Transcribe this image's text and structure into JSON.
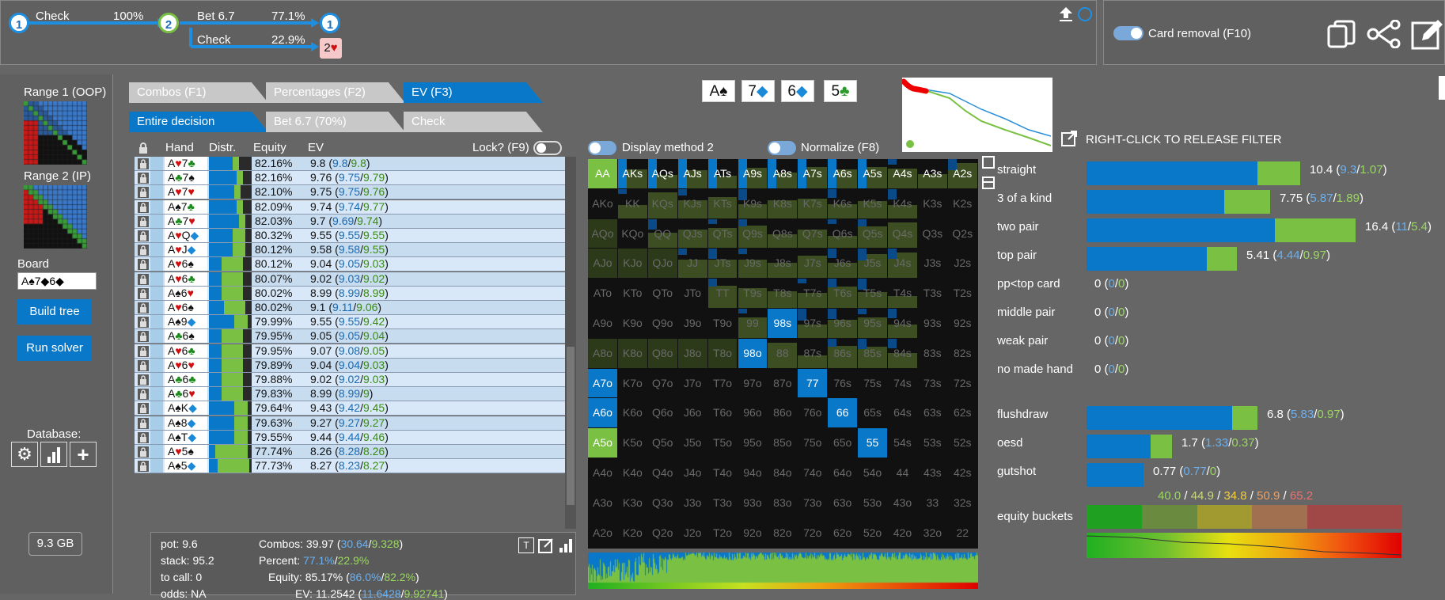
{
  "tree": {
    "n1": "1",
    "n2": "2",
    "n3": "1",
    "n4": "2",
    "check_label": "Check",
    "check_pct": "100%",
    "bet_label": "Bet 6.7",
    "bet_pct": "77.1%",
    "check2_label": "Check",
    "check2_pct": "22.9%",
    "heart": "♥"
  },
  "card_removal_label": "Card removal (F10)",
  "left": {
    "range1": "Range 1 (OOP)",
    "range2": "Range 2 (IP)",
    "board_label": "Board",
    "board_value": "A♠7◆6◆",
    "build_tree": "Build tree",
    "run_solver": "Run solver",
    "database": "Database:",
    "memory": "9.3 GB"
  },
  "tabs1": [
    "Combos (F1)",
    "Percentages (F2)",
    "EV (F3)"
  ],
  "tabs2": [
    "Entire decision",
    "Bet 6.7 (70%)",
    "Check"
  ],
  "board_cards": [
    {
      "rank": "A",
      "suit": "♠",
      "color": "#111"
    },
    {
      "rank": "7",
      "suit": "◆",
      "color": "#1a8ad8"
    },
    {
      "rank": "6",
      "suit": "◆",
      "color": "#1a8ad8"
    },
    {
      "rank": "5",
      "suit": "♣",
      "color": "#2a9a2a"
    }
  ],
  "table": {
    "headers": {
      "hand": "Hand",
      "distr": "Distr.",
      "equity": "Equity",
      "ev": "EV",
      "lock": "Lock? (F9)"
    },
    "rows": [
      {
        "r1": "A",
        "s1": "♥",
        "c1": "#d01010",
        "r2": "7",
        "s2": "♣",
        "c2": "#1a8a1a",
        "equity": "82.16%",
        "ev": "9.8",
        "a": "9.8",
        "b": "9.8",
        "blue": 0.55,
        "green": 0.15
      },
      {
        "r1": "A",
        "s1": "♣",
        "c1": "#1a8a1a",
        "r2": "7",
        "s2": "♠",
        "c2": "#111",
        "equity": "82.16%",
        "ev": "9.76",
        "a": "9.75",
        "b": "9.79",
        "blue": 0.65,
        "green": 0.15
      },
      {
        "r1": "A",
        "s1": "♥",
        "c1": "#d01010",
        "r2": "7",
        "s2": "♥",
        "c2": "#d01010",
        "equity": "82.10%",
        "ev": "9.75",
        "a": "9.75",
        "b": "9.76",
        "blue": 0.6,
        "green": 0.15
      },
      {
        "r1": "A",
        "s1": "♠",
        "c1": "#111",
        "r2": "7",
        "s2": "♣",
        "c2": "#1a8a1a",
        "equity": "82.09%",
        "ev": "9.74",
        "a": "9.74",
        "b": "9.77",
        "blue": 0.65,
        "green": 0.15
      },
      {
        "r1": "A",
        "s1": "♣",
        "c1": "#1a8a1a",
        "r2": "7",
        "s2": "♥",
        "c2": "#d01010",
        "equity": "82.03%",
        "ev": "9.7",
        "a": "9.69",
        "b": "9.74",
        "blue": 0.7,
        "green": 0.15
      },
      {
        "r1": "A",
        "s1": "♥",
        "c1": "#d01010",
        "r2": "Q",
        "s2": "◆",
        "c2": "#1a8ad8",
        "equity": "80.32%",
        "ev": "9.55",
        "a": "9.55",
        "b": "9.55",
        "blue": 0.55,
        "green": 0.3
      },
      {
        "r1": "A",
        "s1": "♥",
        "c1": "#d01010",
        "r2": "J",
        "s2": "◆",
        "c2": "#1a8ad8",
        "equity": "80.12%",
        "ev": "9.58",
        "a": "9.58",
        "b": "9.55",
        "blue": 0.55,
        "green": 0.3
      },
      {
        "r1": "A",
        "s1": "♥",
        "c1": "#d01010",
        "r2": "6",
        "s2": "♠",
        "c2": "#111",
        "equity": "80.12%",
        "ev": "9.04",
        "a": "9.05",
        "b": "9.03",
        "blue": 0.3,
        "green": 0.5
      },
      {
        "r1": "A",
        "s1": "♥",
        "c1": "#d01010",
        "r2": "6",
        "s2": "♣",
        "c2": "#1a8a1a",
        "equity": "80.07%",
        "ev": "9.02",
        "a": "9.03",
        "b": "9.02",
        "blue": 0.3,
        "green": 0.5
      },
      {
        "r1": "A",
        "s1": "♠",
        "c1": "#111",
        "r2": "6",
        "s2": "♥",
        "c2": "#d01010",
        "equity": "80.02%",
        "ev": "8.99",
        "a": "8.99",
        "b": "8.99",
        "blue": 0.3,
        "green": 0.5
      },
      {
        "r1": "A",
        "s1": "♥",
        "c1": "#d01010",
        "r2": "6",
        "s2": "♠",
        "c2": "#111",
        "equity": "80.02%",
        "ev": "9.1",
        "a": "9.11",
        "b": "9.06",
        "blue": 0.35,
        "green": 0.5
      },
      {
        "r1": "A",
        "s1": "♠",
        "c1": "#111",
        "r2": "9",
        "s2": "◆",
        "c2": "#1a8ad8",
        "equity": "79.99%",
        "ev": "9.55",
        "a": "9.55",
        "b": "9.42",
        "blue": 0.6,
        "green": 0.3
      },
      {
        "r1": "A",
        "s1": "♣",
        "c1": "#1a8a1a",
        "r2": "6",
        "s2": "♠",
        "c2": "#111",
        "equity": "79.95%",
        "ev": "9.05",
        "a": "9.05",
        "b": "9.04",
        "blue": 0.3,
        "green": 0.5
      },
      {
        "r1": "A",
        "s1": "♥",
        "c1": "#d01010",
        "r2": "6",
        "s2": "♣",
        "c2": "#1a8a1a",
        "equity": "79.95%",
        "ev": "9.07",
        "a": "9.08",
        "b": "9.05",
        "blue": 0.3,
        "green": 0.5
      },
      {
        "r1": "A",
        "s1": "♥",
        "c1": "#d01010",
        "r2": "6",
        "s2": "♥",
        "c2": "#d01010",
        "equity": "79.89%",
        "ev": "9.04",
        "a": "9.04",
        "b": "9.03",
        "blue": 0.3,
        "green": 0.5
      },
      {
        "r1": "A",
        "s1": "♣",
        "c1": "#1a8a1a",
        "r2": "6",
        "s2": "♣",
        "c2": "#1a8a1a",
        "equity": "79.88%",
        "ev": "9.02",
        "a": "9.02",
        "b": "9.03",
        "blue": 0.3,
        "green": 0.5
      },
      {
        "r1": "A",
        "s1": "♣",
        "c1": "#1a8a1a",
        "r2": "6",
        "s2": "♥",
        "c2": "#d01010",
        "equity": "79.83%",
        "ev": "8.99",
        "a": "8.99",
        "b": "9",
        "blue": 0.3,
        "green": 0.5
      },
      {
        "r1": "A",
        "s1": "♠",
        "c1": "#111",
        "r2": "K",
        "s2": "◆",
        "c2": "#1a8ad8",
        "equity": "79.64%",
        "ev": "9.43",
        "a": "9.42",
        "b": "9.45",
        "blue": 0.6,
        "green": 0.3
      },
      {
        "r1": "A",
        "s1": "♠",
        "c1": "#111",
        "r2": "8",
        "s2": "◆",
        "c2": "#1a8ad8",
        "equity": "79.63%",
        "ev": "9.27",
        "a": "9.27",
        "b": "9.27",
        "blue": 0.6,
        "green": 0.3
      },
      {
        "r1": "A",
        "s1": "♠",
        "c1": "#111",
        "r2": "T",
        "s2": "◆",
        "c2": "#1a8ad8",
        "equity": "79.55%",
        "ev": "9.44",
        "a": "9.44",
        "b": "9.46",
        "blue": 0.6,
        "green": 0.3
      },
      {
        "r1": "A",
        "s1": "♥",
        "c1": "#d01010",
        "r2": "5",
        "s2": "♠",
        "c2": "#111",
        "equity": "77.74%",
        "ev": "8.26",
        "a": "8.28",
        "b": "8.26",
        "blue": 0.15,
        "green": 0.75
      },
      {
        "r1": "A",
        "s1": "♠",
        "c1": "#111",
        "r2": "5",
        "s2": "◆",
        "c2": "#1a8ad8",
        "equity": "77.73%",
        "ev": "8.27",
        "a": "8.23",
        "b": "8.27",
        "blue": 0.2,
        "green": 0.75
      }
    ]
  },
  "summary": {
    "pot": "pot: 9.6",
    "stack": "stack: 95.2",
    "tocall": "to call: 0",
    "odds": "odds: NA",
    "combos_label": "Combos:",
    "combos_val": "39.97",
    "combos_a": "30.64",
    "combos_b": "9.328",
    "percent_label": "Percent:",
    "percent_a": "77.1%",
    "percent_b": "22.9%",
    "equity_label": "Equity:",
    "equity_val": "85.17%",
    "equity_a": "86.0%",
    "equity_b": "82.2%",
    "ev_label": "EV:",
    "ev_val": "11.2542",
    "ev_a": "11.6428",
    "ev_b": "9.92741"
  },
  "toggles": {
    "display_method": "Display method 2",
    "normalize": "Normalize (F8)"
  },
  "filter_hint": "RIGHT-CLICK TO RELEASE FILTER",
  "grid_labels": [
    [
      "AA",
      "AKs",
      "AQs",
      "AJs",
      "ATs",
      "A9s",
      "A8s",
      "A7s",
      "A6s",
      "A5s",
      "A4s",
      "A3s",
      "A2s"
    ],
    [
      "AKo",
      "KK",
      "KQs",
      "KJs",
      "KTs",
      "K9s",
      "K8s",
      "K7s",
      "K6s",
      "K5s",
      "K4s",
      "K3s",
      "K2s"
    ],
    [
      "AQo",
      "KQo",
      "QQ",
      "QJs",
      "QTs",
      "Q9s",
      "Q8s",
      "Q7s",
      "Q6s",
      "Q5s",
      "Q4s",
      "Q3s",
      "Q2s"
    ],
    [
      "AJo",
      "KJo",
      "QJo",
      "JJ",
      "JTs",
      "J9s",
      "J8s",
      "J7s",
      "J6s",
      "J5s",
      "J4s",
      "J3s",
      "J2s"
    ],
    [
      "ATo",
      "KTo",
      "QTo",
      "JTo",
      "TT",
      "T9s",
      "T8s",
      "T7s",
      "T6s",
      "T5s",
      "T4s",
      "T3s",
      "T2s"
    ],
    [
      "A9o",
      "K9o",
      "Q9o",
      "J9o",
      "T9o",
      "99",
      "98s",
      "97s",
      "96s",
      "95s",
      "94s",
      "93s",
      "92s"
    ],
    [
      "A8o",
      "K8o",
      "Q8o",
      "J8o",
      "T8o",
      "98o",
      "88",
      "87s",
      "86s",
      "85s",
      "84s",
      "83s",
      "82s"
    ],
    [
      "A7o",
      "K7o",
      "Q7o",
      "J7o",
      "T7o",
      "97o",
      "87o",
      "77",
      "76s",
      "75s",
      "74s",
      "73s",
      "72s"
    ],
    [
      "A6o",
      "K6o",
      "Q6o",
      "J6o",
      "T6o",
      "96o",
      "86o",
      "76o",
      "66",
      "65s",
      "64s",
      "63s",
      "62s"
    ],
    [
      "A5o",
      "K5o",
      "Q5o",
      "J5o",
      "T5o",
      "95o",
      "85o",
      "75o",
      "65o",
      "55",
      "54s",
      "53s",
      "52s"
    ],
    [
      "A4o",
      "K4o",
      "Q4o",
      "J4o",
      "T4o",
      "94o",
      "84o",
      "74o",
      "64o",
      "54o",
      "44",
      "43s",
      "42s"
    ],
    [
      "A3o",
      "K3o",
      "Q3o",
      "J3o",
      "T3o",
      "93o",
      "83o",
      "73o",
      "63o",
      "53o",
      "43o",
      "33",
      "32s"
    ],
    [
      "A2o",
      "K2o",
      "Q2o",
      "J2o",
      "T2o",
      "92o",
      "82o",
      "72o",
      "62o",
      "52o",
      "42o",
      "32o",
      "22"
    ]
  ],
  "stats": [
    {
      "label": "straight",
      "val": "10.4",
      "a": "9.3",
      "b": "1.07",
      "w": 270,
      "blue": 0.8
    },
    {
      "label": "3 of a kind",
      "val": "7.75",
      "a": "5.87",
      "b": "1.89",
      "w": 232,
      "blue": 0.75
    },
    {
      "label": "two pair",
      "val": "16.4",
      "a": "11",
      "b": "5.4",
      "w": 340,
      "blue": 0.7
    },
    {
      "label": "top pair",
      "val": "5.41",
      "a": "4.44",
      "b": "0.97",
      "w": 190,
      "blue": 0.8
    },
    {
      "label": "pp<top card",
      "val": "0",
      "a": "0",
      "b": "0",
      "w": 0,
      "blue": 0
    },
    {
      "label": "middle pair",
      "val": "0",
      "a": "0",
      "b": "0",
      "w": 0,
      "blue": 0
    },
    {
      "label": "weak pair",
      "val": "0",
      "a": "0",
      "b": "0",
      "w": 0,
      "blue": 0
    },
    {
      "label": "no made hand",
      "val": "0",
      "a": "0",
      "b": "0",
      "w": 0,
      "blue": 0
    }
  ],
  "draws": [
    {
      "label": "flushdraw",
      "val": "6.8",
      "a": "5.83",
      "b": "0.97",
      "w": 216,
      "blue": 0.85
    },
    {
      "label": "oesd",
      "val": "1.7",
      "a": "1.33",
      "b": "0.37",
      "w": 108,
      "blue": 0.75
    },
    {
      "label": "gutshot",
      "val": "0.77",
      "a": "0.77",
      "b": "0",
      "w": 72,
      "blue": 1
    }
  ],
  "equity_buckets": {
    "label": "equity buckets",
    "v1": "40.0",
    "v2": "44.9",
    "v3": "34.8",
    "v4": "50.9",
    "v5": "65.2",
    "sep": " / "
  },
  "colors": {
    "blue": "#0a78c8",
    "green": "#7ac143",
    "panel": "#606060"
  }
}
